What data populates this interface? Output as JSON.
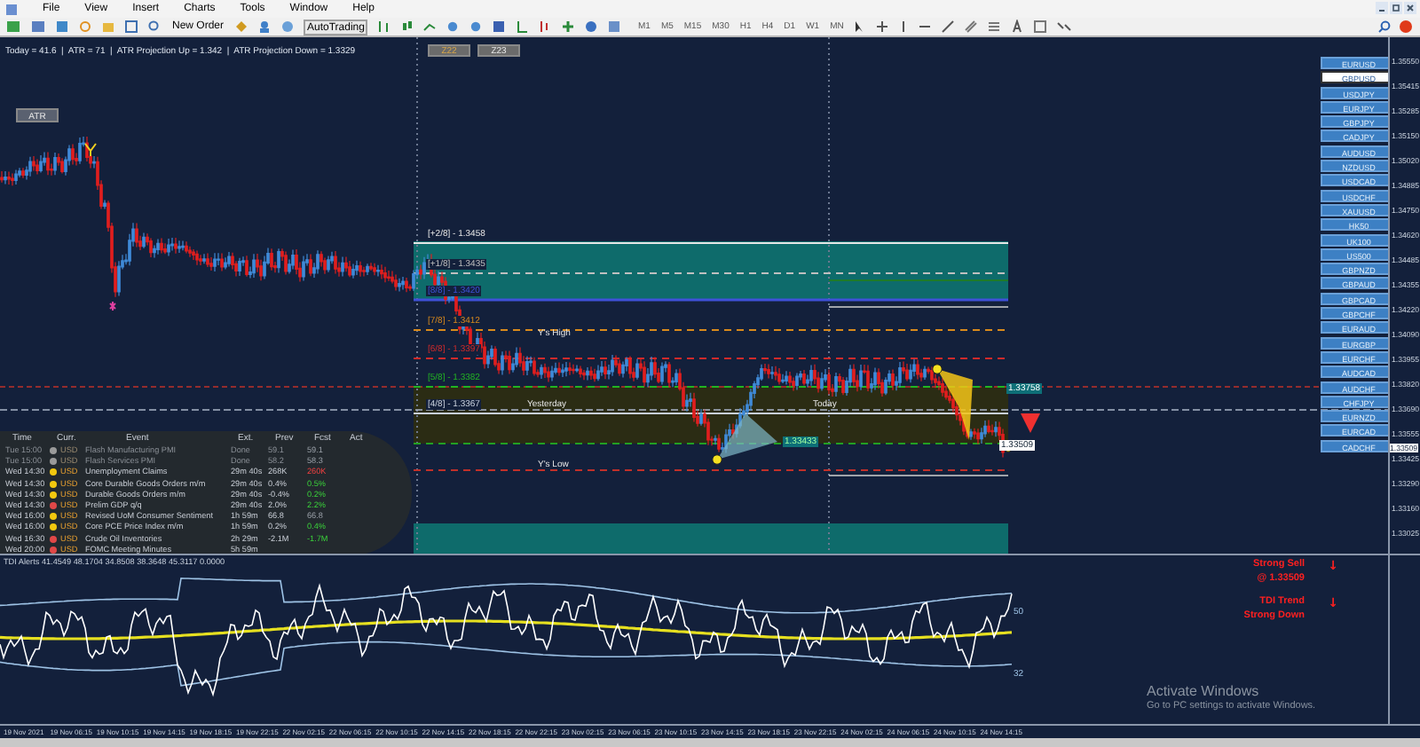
{
  "menu": [
    "File",
    "View",
    "Insert",
    "Charts",
    "Tools",
    "Window",
    "Help"
  ],
  "toolbar": {
    "new_order": "New Order",
    "autotrading": "AutoTrading",
    "timeframes": [
      "M1",
      "M5",
      "M15",
      "M30",
      "H1",
      "H4",
      "D1",
      "W1",
      "MN"
    ]
  },
  "chart": {
    "info_line": "Today = 41.6  |  ATR = 71  |  ATR Projection Up = 1.342  |  ATR Projection Down = 1.3329",
    "zone_buttons": [
      {
        "label": "Z22",
        "selected": true
      },
      {
        "label": "Z23",
        "selected": false
      }
    ],
    "atr_button": "ATR",
    "levels": [
      "[+2/8] - 1.3458",
      "[+1/8] - 1.3435",
      "[8/8] - 1.3420",
      "[7/8] - 1.3412",
      "[6/8] - 1.3397",
      "[5/8] - 1.3382",
      "[4/8] - 1.3367"
    ],
    "markers": [
      "Y's High",
      "Yesterday",
      "Today",
      "Y's Low"
    ],
    "price_tags": [
      "1.33758",
      "1.33433",
      "1.33509"
    ],
    "price_axis": [
      "1.35550",
      "1.35415",
      "1.35285",
      "1.35150",
      "1.35020",
      "1.34885",
      "1.34750",
      "1.34620",
      "1.34485",
      "1.34355",
      "1.34220",
      "1.34090",
      "1.33955",
      "1.33820",
      "1.33690",
      "1.33555",
      "1.33425",
      "1.33290",
      "1.33160",
      "1.33025"
    ],
    "bid_price": "1.33509"
  },
  "symbols": [
    {
      "label": "EURUSD",
      "selected": false
    },
    {
      "label": "GBPUSD",
      "selected": true
    },
    {
      "label": "USDJPY",
      "selected": false
    },
    {
      "label": "EURJPY",
      "selected": false
    },
    {
      "label": "GBPJPY",
      "selected": false
    },
    {
      "label": "CADJPY",
      "selected": false
    },
    {
      "label": "AUDUSD",
      "selected": false
    },
    {
      "label": "NZDUSD",
      "selected": false
    },
    {
      "label": "USDCAD",
      "selected": false
    },
    {
      "label": "USDCHF",
      "selected": false
    },
    {
      "label": "XAUUSD",
      "selected": false
    },
    {
      "label": "HK50",
      "selected": false
    },
    {
      "label": "UK100",
      "selected": false
    },
    {
      "label": "US500",
      "selected": false
    },
    {
      "label": "GBPNZD",
      "selected": false
    },
    {
      "label": "GBPAUD",
      "selected": false
    },
    {
      "label": "GBPCAD",
      "selected": false
    },
    {
      "label": "GBPCHF",
      "selected": false
    },
    {
      "label": "EURAUD",
      "selected": false
    },
    {
      "label": "EURGBP",
      "selected": false
    },
    {
      "label": "EURCHF",
      "selected": false
    },
    {
      "label": "AUDCAD",
      "selected": false
    },
    {
      "label": "AUDCHF",
      "selected": false
    },
    {
      "label": "CHFJPY",
      "selected": false
    },
    {
      "label": "EURNZD",
      "selected": false
    },
    {
      "label": "EURCAD",
      "selected": false
    },
    {
      "label": "CADCHF",
      "selected": false
    }
  ],
  "news": {
    "columns": [
      "Time",
      "Curr.",
      "Event",
      "Ext.",
      "Prev",
      "Fcst",
      "Act"
    ],
    "rows": [
      {
        "time": "Tue 15:00",
        "currency": "USD",
        "event": "Flash Manufacturing PMI",
        "ext": "Done",
        "prev": "59.1",
        "fcst": {
          "text": "59.1",
          "kind": "neutral"
        },
        "past": true,
        "color": "#9a9a9a"
      },
      {
        "time": "Tue 15:00",
        "currency": "USD",
        "event": "Flash Services PMI",
        "ext": "Done",
        "prev": "58.2",
        "fcst": {
          "text": "58.3",
          "kind": "neutral"
        },
        "past": true,
        "color": "#9a9a9a"
      },
      {
        "time": "Wed 14:30",
        "currency": "USD",
        "event": "Unemployment Claims",
        "ext": "29m 40s",
        "prev": "268K",
        "fcst": {
          "text": "260K",
          "kind": "worse"
        },
        "past": false,
        "color": "#f2c80f"
      },
      {
        "time": "Wed 14:30",
        "currency": "USD",
        "event": "Core Durable Goods Orders m/m",
        "ext": "29m 40s",
        "prev": "0.4%",
        "fcst": {
          "text": "0.5%",
          "kind": "better"
        },
        "past": false,
        "color": "#f2c80f"
      },
      {
        "time": "Wed 14:30",
        "currency": "USD",
        "event": "Durable Goods Orders m/m",
        "ext": "29m 40s",
        "prev": "-0.4%",
        "fcst": {
          "text": "0.2%",
          "kind": "better"
        },
        "past": false,
        "color": "#f2c80f"
      },
      {
        "time": "Wed 14:30",
        "currency": "USD",
        "event": "Prelim GDP q/q",
        "ext": "29m 40s",
        "prev": "2.0%",
        "fcst": {
          "text": "2.2%",
          "kind": "better"
        },
        "past": false,
        "color": "#e04848"
      },
      {
        "time": "Wed 16:00",
        "currency": "USD",
        "event": "Revised UoM Consumer Sentiment",
        "ext": "1h 59m",
        "prev": "66.8",
        "fcst": {
          "text": "66.8",
          "kind": "neutral"
        },
        "past": false,
        "color": "#f2c80f"
      },
      {
        "time": "Wed 16:00",
        "currency": "USD",
        "event": "Core PCE Price Index m/m",
        "ext": "1h 59m",
        "prev": "0.2%",
        "fcst": {
          "text": "0.4%",
          "kind": "better"
        },
        "past": false,
        "color": "#f2c80f"
      },
      {
        "time": "Wed 16:30",
        "currency": "USD",
        "event": "Crude Oil Inventories",
        "ext": "2h 29m",
        "prev": "-2.1M",
        "fcst": {
          "text": "-1.7M",
          "kind": "better"
        },
        "past": false,
        "color": "#e04848"
      },
      {
        "time": "Wed 20:00",
        "currency": "USD",
        "event": "FOMC Meeting Minutes",
        "ext": "5h 59m",
        "past": false,
        "color": "#e04848"
      }
    ]
  },
  "tdi": {
    "header": "TDI Alerts 41.4549 48.1704 34.8508 38.3648 45.3117 0.0000",
    "levels": [
      "50",
      "32"
    ],
    "signals": [
      {
        "lines": [
          "Strong Sell",
          "@ 1.33509"
        ],
        "arrow": "↓"
      },
      {
        "lines": [
          "TDI Trend",
          "Strong Down"
        ],
        "arrow": "↓"
      }
    ]
  },
  "watermark": {
    "title": "Activate Windows",
    "subtitle": "Go to PC settings to activate Windows."
  },
  "time_axis": [
    "19 Nov 2021",
    "19 Nov 06:15",
    "19 Nov 10:15",
    "19 Nov 14:15",
    "19 Nov 18:15",
    "19 Nov 22:15",
    "22 Nov 02:15",
    "22 Nov 06:15",
    "22 Nov 10:15",
    "22 Nov 14:15",
    "22 Nov 18:15",
    "22 Nov 22:15",
    "23 Nov 02:15",
    "23 Nov 06:15",
    "23 Nov 10:15",
    "23 Nov 14:15",
    "23 Nov 18:15",
    "23 Nov 22:15",
    "24 Nov 02:15",
    "24 Nov 06:15",
    "24 Nov 10:15",
    "24 Nov 14:15"
  ]
}
